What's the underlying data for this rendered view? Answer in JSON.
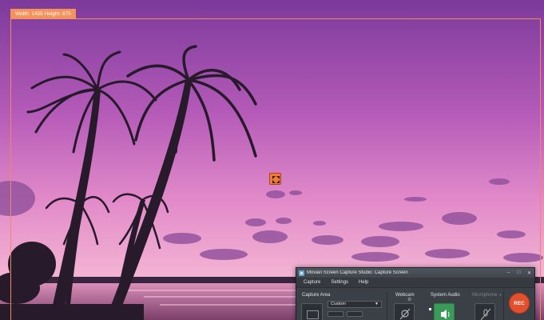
{
  "overlay": {
    "dimensions_label": "Width: 1455 Height: 875"
  },
  "window": {
    "title": "Movavi Screen Capture Studio: Capture Screen",
    "controls": [
      "–",
      "□",
      "✕"
    ]
  },
  "menu": {
    "items": [
      "Capture",
      "Settings",
      "Help"
    ]
  },
  "capture_area": {
    "label": "Capture Area",
    "selected": "Custom"
  },
  "webcam": {
    "label": "Webcam"
  },
  "system_audio": {
    "label": "System Audio"
  },
  "microphone": {
    "label": "Microphone"
  },
  "record": {
    "label": "REC"
  },
  "icons": {
    "app": "movavi-app-icon",
    "area": "capture-area-icon",
    "webcam": "webcam-off-icon",
    "audio": "speaker-icon",
    "mic": "microphone-off-icon",
    "move": "move-arrows-icon",
    "gear": "gear-icon"
  },
  "colors": {
    "frame": "#f08a5d",
    "rec": "#e2502d",
    "audio_active": "#3a9a5a"
  }
}
